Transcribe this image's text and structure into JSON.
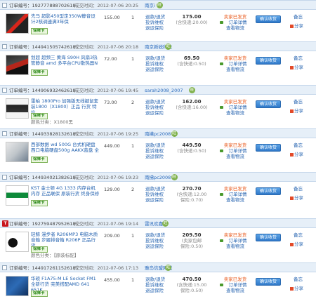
{
  "labels": {
    "order_number": "订单编号：",
    "deal_time": "成交时间：",
    "wangwang": "旺",
    "t_badge": "T",
    "buyer_protection_bold": "保障卡",
    "action_request_refund": "退款/退货",
    "action_complaint": "投诉维权",
    "action_return": "退运保险",
    "status_shipped": "卖家已发货",
    "status_view_detail": "订单详情",
    "status_view_logistics": "查看物流",
    "confirm_button": "确认收货",
    "note_label": "备忘",
    "share_label": "分享"
  },
  "orders": [
    {
      "order_no": "192777888702618",
      "time": "2012-07-06 20:25",
      "seller": "南京i",
      "title": "先马 超影450型定350W静音设计2核调速满3年保",
      "category": "",
      "price": "155.00",
      "qty": "1",
      "total": "175.00",
      "shipping": "(含快递:20.00)",
      "status": "卖家已发货",
      "icon": "power-supply"
    },
    {
      "order_no": "144941505742618",
      "time": "2012-07-06 20:18",
      "seller": "南京新锐科技",
      "title": "划超 超频三 黄海 S90H 风扇3热管静音 amd 多平台CPU散热器N",
      "category": "",
      "price": "72.00",
      "qty": "1",
      "total": "69.50",
      "shipping": "(含快递:0.50)",
      "status": "卖家已发货",
      "icon": "cpu-cooler"
    },
    {
      "order_no": "144906932462618",
      "time": "2012-07-06 19:45",
      "seller": "sarah2008_2007",
      "title": "雷柏 1800Pro 加强版无线键鼠套装1800（X1800）正品 行货 特价",
      "category": "颜色分类：X1800黑",
      "price": "73.00",
      "qty": "2",
      "total": "162.00",
      "shipping": "(含快递:16.00)",
      "status": "卖家已发货",
      "icon": "keyboard"
    },
    {
      "order_no": "144933828132618",
      "time": "2012-07-06 19:25",
      "seller": "南拂pc2008",
      "title": "西部数据 wd 500G 台式机硬盘 西口电脑硬盘500g AAKX蓝盘 全",
      "category": "",
      "price": "449.00",
      "qty": "1",
      "total": "449.50",
      "shipping": "(含快递:0.50)",
      "status": "卖家已发货",
      "icon": "hard-drive"
    },
    {
      "order_no": "144934021382618",
      "time": "2012-07-06 19:23",
      "seller": "南拂pc2008",
      "title": "KST 金士顿 4G 1333 内存台机内存 正品联保 原装行货 终身保修",
      "category": "",
      "price": "129.00",
      "qty": "2",
      "total": "270.70",
      "shipping": "(含快递:12.00",
      "shipping2": "保险:0.70)",
      "status": "卖家已发货",
      "icon": "memory"
    },
    {
      "order_no": "192759487952618",
      "time": "2012-07-06 19:14",
      "seller": "雷讯欢嘉科",
      "title": "轻鲸 漫步者 R206MP3 电脑木质音箱 步履排音箱 R206P 正品行货",
      "category": "颜色分类：【原装标配】",
      "price": "209.00",
      "qty": "1",
      "total": "209.50",
      "shipping": "(卖家包邮",
      "shipping2": "保险:0.50)",
      "status": "卖家已发货",
      "icon": "speakers"
    },
    {
      "order_no": "144917261152618",
      "time": "2012-07-06 17:13",
      "seller": "雅岛信盟网城",
      "title": "华硕 F1A75-M LE Socket FM1 全新行货 完美搭配AMD 641 651K",
      "category": "",
      "price": "455.00",
      "qty": "1",
      "total": "470.50",
      "shipping": "(含快递:15.00",
      "shipping2": "保险:0.50)",
      "status": "卖家已发货",
      "icon": "motherboard"
    }
  ]
}
